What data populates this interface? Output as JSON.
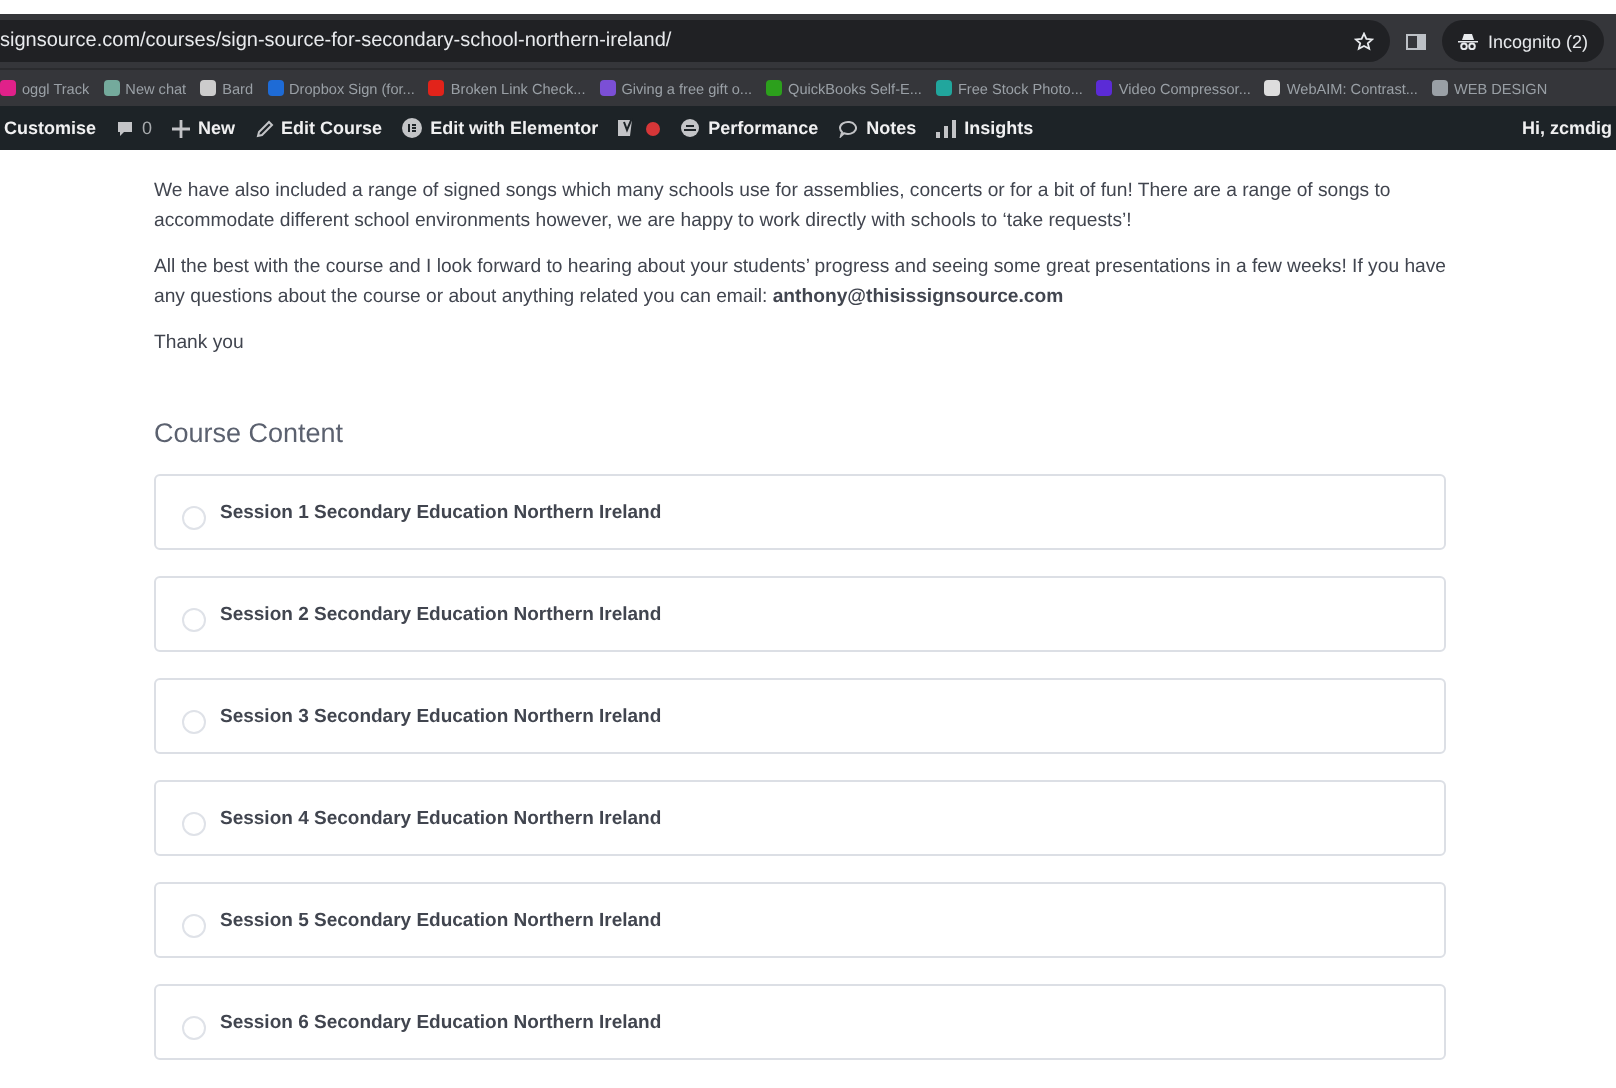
{
  "browser": {
    "url": "signsource.com/courses/sign-source-for-secondary-school-northern-ireland/",
    "profile": "Incognito (2)"
  },
  "bookmarks": [
    {
      "label": "oggl Track",
      "color": "#e0218a"
    },
    {
      "label": "New chat",
      "color": "#74aa9c"
    },
    {
      "label": "Bard",
      "color": "#cccccc"
    },
    {
      "label": "Dropbox Sign (for...",
      "color": "#1e6bd6"
    },
    {
      "label": "Broken Link Check...",
      "color": "#e2231a"
    },
    {
      "label": "Giving a free gift o...",
      "color": "#7b4fd6"
    },
    {
      "label": "QuickBooks Self-E...",
      "color": "#2ca01c"
    },
    {
      "label": "Free Stock Photo...",
      "color": "#21a69d"
    },
    {
      "label": "Video Compressor...",
      "color": "#5b2bd6"
    },
    {
      "label": "WebAIM: Contrast...",
      "color": "#dddddd"
    },
    {
      "label": "WEB DESIGN",
      "color": "#9aa0a6"
    }
  ],
  "admin_bar": {
    "items": [
      {
        "label": "Customise",
        "kind": "text"
      },
      {
        "label": "0",
        "kind": "comments"
      },
      {
        "label": "New",
        "kind": "new"
      },
      {
        "label": "Edit Course",
        "kind": "edit"
      },
      {
        "label": "Edit with Elementor",
        "kind": "elementor"
      },
      {
        "kind": "seo"
      },
      {
        "label": "Performance",
        "kind": "performance"
      },
      {
        "label": "Notes",
        "kind": "notes"
      },
      {
        "label": "Insights",
        "kind": "insights"
      }
    ],
    "greeting": "Hi, zcmdig"
  },
  "paragraphs": [
    "We have also included a range of signed songs which many schools use for assemblies, concerts or for a bit of fun! There are a range of songs to accommodate different school environments however, we are happy to work directly with schools to ‘take requests’!",
    "All the best with the course and I look forward to hearing about your students’ progress and seeing some great presentations in a few weeks! If you have any questions about the course or about anything related you can email: **anthony@thisissignsource.com**",
    "Thank you"
  ],
  "course_content": {
    "title": "Course Content",
    "sessions": [
      {
        "title": "Session 1 Secondary Education Northern Ireland",
        "completed": false
      },
      {
        "title": "Session 2 Secondary Education Northern Ireland",
        "completed": false
      },
      {
        "title": "Session 3 Secondary Education Northern Ireland",
        "completed": false
      },
      {
        "title": "Session 4 Secondary Education Northern Ireland",
        "completed": false
      },
      {
        "title": "Session 5 Secondary Education Northern Ireland",
        "completed": false
      },
      {
        "title": "Session 6 Secondary Education Northern Ireland",
        "completed": false
      }
    ]
  }
}
